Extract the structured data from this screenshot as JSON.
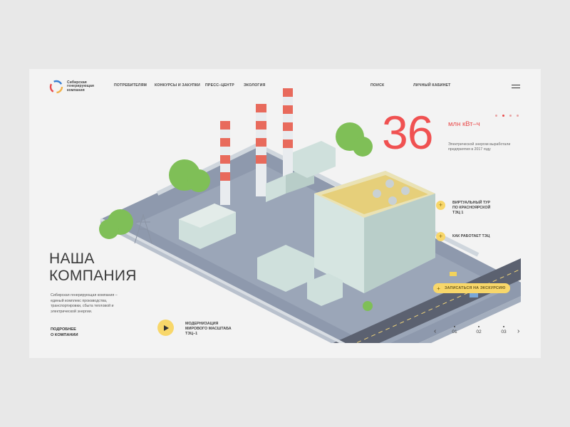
{
  "logo": {
    "lines": [
      "Сибирская",
      "генерирующая",
      "компания"
    ]
  },
  "nav": {
    "items": [
      "ПОТРЕБИТЕЛЯМ",
      "КОНКУРСЫ И ЗАКУПКИ",
      "ПРЕСС–ЦЕНТР",
      "ЭКОЛОГИЯ"
    ],
    "search": "ПОИСК",
    "cabinet": "ЛИЧНЫЙ КАБИНЕТ"
  },
  "stat": {
    "number": "36",
    "unit": "млн кВт–ч",
    "description": "Электрической энергии выработали предприятия в 2017 году"
  },
  "hero": {
    "title_line1": "НАША",
    "title_line2": "КОМПАНИЯ",
    "description": "Сибирская генерирующая компания – единый комплекс производства, транспортировки, сбыта тепловой и электрической энергии.",
    "more_line1": "ПОДРОБНЕЕ",
    "more_line2": "О КОМПАНИИ"
  },
  "video": {
    "line1": "МОДЕРНИЗАЦИЯ",
    "line2": "МИРОВОГО МАСШТАБА",
    "line3": "ТЭЦ–1"
  },
  "hotspots": {
    "tour_line1": "ВИРТУАЛЬНЫЙ ТУР",
    "tour_line2": "ПО КРАСНОЯРСКОЙ",
    "tour_line3": "ТЭЦ 1",
    "works": "КАК РАБОТАЕТ ТЭЦ",
    "excursion": "ЗАПИСАТЬСЯ НА ЭКСКУРСИЮ"
  },
  "pagination": {
    "pages": [
      "01",
      "02",
      "03"
    ],
    "prev": "‹",
    "next": "›"
  },
  "colors": {
    "accent_red": "#f05151",
    "accent_yellow": "#f8d76a",
    "background": "#f3f3f3"
  }
}
